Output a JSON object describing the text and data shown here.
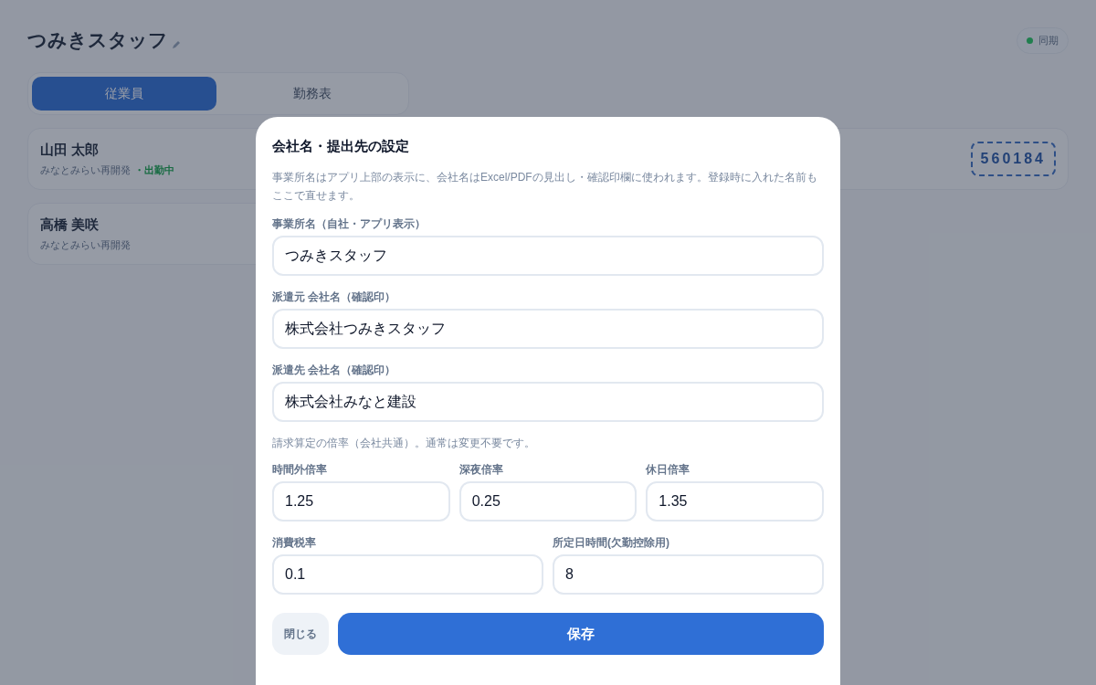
{
  "header": {
    "title": "つみきスタッフ",
    "sync": {
      "label": "同期",
      "connected": true
    }
  },
  "tabs": [
    {
      "label": "従業員",
      "selected": true
    },
    {
      "label": "勤務表",
      "selected": false
    }
  ],
  "employees": [
    {
      "name": "山田 太郎",
      "site": "みなとみらい再開発",
      "status": "・出勤中",
      "code": "560184"
    },
    {
      "name": "高橋 美咲",
      "site": "みなとみらい再開発"
    }
  ],
  "modal": {
    "title": "会社名・提出先の設定",
    "description": "事業所名はアプリ上部の表示に、会社名はExcel/PDFの見出し・確認印欄に使われます。登録時に入れた名前もここで直せます。",
    "fields": [
      {
        "label": "事業所名（自社・アプリ表示）",
        "value": "つみきスタッフ"
      },
      {
        "label": "派遣元 会社名（確認印）",
        "value": "株式会社つみきスタッフ"
      },
      {
        "label": "派遣先 会社名（確認印）",
        "value": "株式会社みなと建設"
      }
    ],
    "rates_note": "請求算定の倍率（会社共通）。通常は変更不要です。",
    "rate_rows": [
      [
        {
          "label": "時間外倍率",
          "value": "1.25"
        },
        {
          "label": "深夜倍率",
          "value": "0.25"
        },
        {
          "label": "休日倍率",
          "value": "1.35"
        }
      ],
      [
        {
          "label": "消費税率",
          "value": "0.1"
        },
        {
          "label": "所定日時間(欠勤控除用)",
          "value": "8"
        }
      ]
    ],
    "close_button": "閉じる",
    "save_button": "保存"
  }
}
